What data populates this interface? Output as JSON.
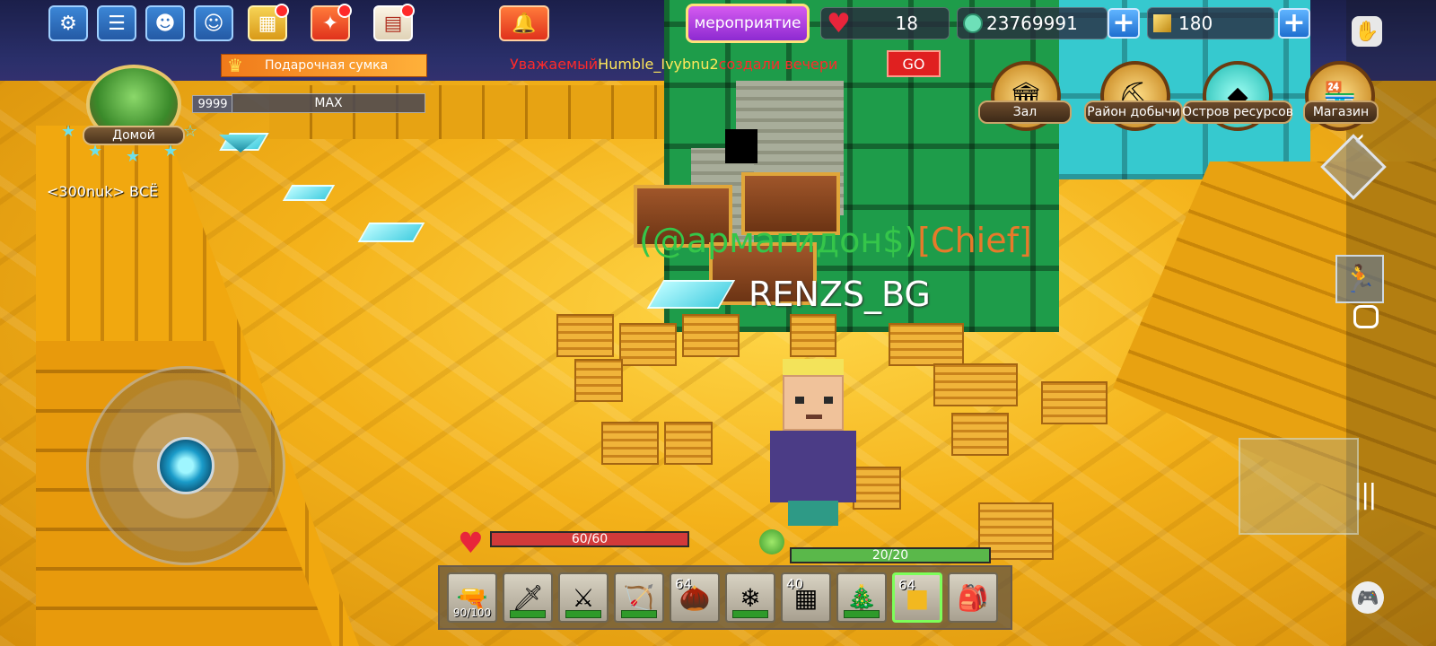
{
  "top_menu": {
    "icons": [
      "gear-icon",
      "chat-icon",
      "robot-face-icon",
      "profile-card-icon",
      "game-mode-icon",
      "party-popper-icon",
      "notes-icon",
      "bell-icon"
    ],
    "event_label": "мероприятие"
  },
  "stats": {
    "hearts": "18",
    "coins": "23769991",
    "gold": "180"
  },
  "announcement": {
    "prefix": "Уважаемый",
    "user": "Humble_Ivybnu2",
    "suffix": "создали вечери",
    "go_label": "GO"
  },
  "gift_bag": {
    "label": "Подарочная сумка"
  },
  "home": {
    "label": "Домой",
    "level": "9999",
    "level_bar_label": "MAX"
  },
  "player_tag": "<300nuk> ВСЁ",
  "locations": [
    {
      "label": "Зал",
      "icon": "hall-icon"
    },
    {
      "label": "Район добычи",
      "icon": "mining-icon"
    },
    {
      "label": "Остров ресурсов",
      "icon": "island-icon"
    },
    {
      "label": "Магазин",
      "icon": "shop-icon"
    }
  ],
  "nameplate": {
    "guild": "(@армагидон$)",
    "rank": "[Chief]",
    "player": "RENZS_BG"
  },
  "vitals": {
    "health": "60/60",
    "health_fraction": 1.0,
    "hunger": "20/20",
    "hunger_fraction": 1.0
  },
  "hotbar": [
    {
      "icon": "ray-gun-icon",
      "count": "",
      "durability": "90/100",
      "active": false
    },
    {
      "icon": "sword-icon",
      "count": "",
      "durability": "",
      "active": false
    },
    {
      "icon": "purple-sword-icon",
      "count": "",
      "durability": "",
      "active": false
    },
    {
      "icon": "bow-icon",
      "count": "",
      "durability": "",
      "active": false
    },
    {
      "icon": "nut-icon",
      "count": "64",
      "durability": "",
      "active": false
    },
    {
      "icon": "crystal-icon",
      "count": "",
      "durability": "",
      "active": false
    },
    {
      "icon": "money-stack-icon",
      "count": "40",
      "durability": "",
      "active": false
    },
    {
      "icon": "christmas-tree-icon",
      "count": "",
      "durability": "",
      "active": false
    },
    {
      "icon": "gold-block-icon",
      "count": "64",
      "durability": "",
      "active": true
    },
    {
      "icon": "backpack-icon",
      "count": "",
      "durability": "",
      "active": false
    }
  ],
  "colors": {
    "health": "#d23a3a",
    "hunger": "#5ab84a",
    "guild_green": "#35c64a",
    "rank_orange": "#e77a2a",
    "announce_red": "#ff2a2a",
    "announce_user": "#ffe85a"
  }
}
